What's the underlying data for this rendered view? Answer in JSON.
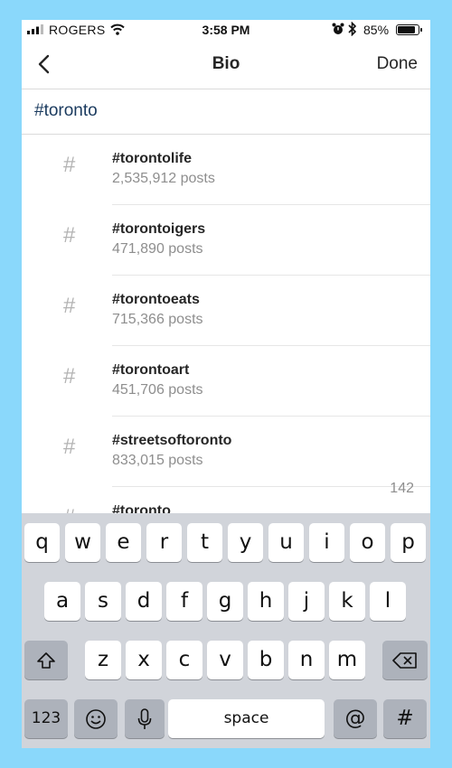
{
  "status_bar": {
    "carrier": "ROGERS",
    "time": "3:58 PM",
    "battery_percent": "85%"
  },
  "nav": {
    "title": "Bio",
    "done_label": "Done",
    "back_icon": "chevron-left-icon"
  },
  "bio": {
    "value": "#toronto"
  },
  "suggestions": [
    {
      "tag": "#torontolife",
      "count": "2,535,912 posts"
    },
    {
      "tag": "#torontoigers",
      "count": "471,890 posts"
    },
    {
      "tag": "#torontoeats",
      "count": "715,366 posts"
    },
    {
      "tag": "#torontoart",
      "count": "451,706 posts"
    },
    {
      "tag": "#streetsoftoronto",
      "count": "833,015 posts"
    },
    {
      "tag": "#toronto",
      "count": ""
    }
  ],
  "char_remaining": "142",
  "keyboard": {
    "row1": [
      "q",
      "w",
      "e",
      "r",
      "t",
      "y",
      "u",
      "i",
      "o",
      "p"
    ],
    "row2": [
      "a",
      "s",
      "d",
      "f",
      "g",
      "h",
      "j",
      "k",
      "l"
    ],
    "row3": [
      "z",
      "x",
      "c",
      "v",
      "b",
      "n",
      "m"
    ],
    "numbers_label": "123",
    "space_label": "space",
    "at_label": "@",
    "hash_label": "#"
  }
}
